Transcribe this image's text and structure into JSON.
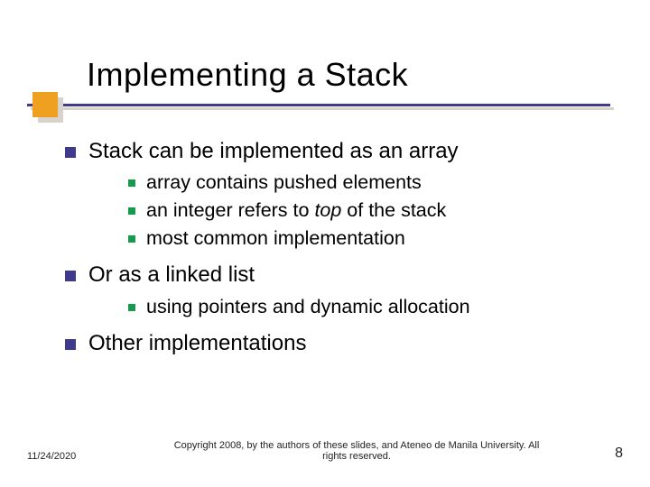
{
  "title": "Implementing a Stack",
  "bullets": [
    {
      "text": "Stack can be implemented as an array",
      "sub": [
        {
          "text": "array contains pushed elements"
        },
        {
          "prefix": "an integer refers to ",
          "em": "top",
          "suffix": " of the stack"
        },
        {
          "text": "most common implementation"
        }
      ]
    },
    {
      "text": "Or as a linked list",
      "sub": [
        {
          "text": "using pointers and dynamic allocation"
        }
      ]
    },
    {
      "text": "Other implementations",
      "sub": []
    }
  ],
  "footer": {
    "date": "11/24/2020",
    "copyright": "Copyright 2008, by the authors of these slides, and Ateneo de Manila University. All rights reserved.",
    "page": "8"
  }
}
